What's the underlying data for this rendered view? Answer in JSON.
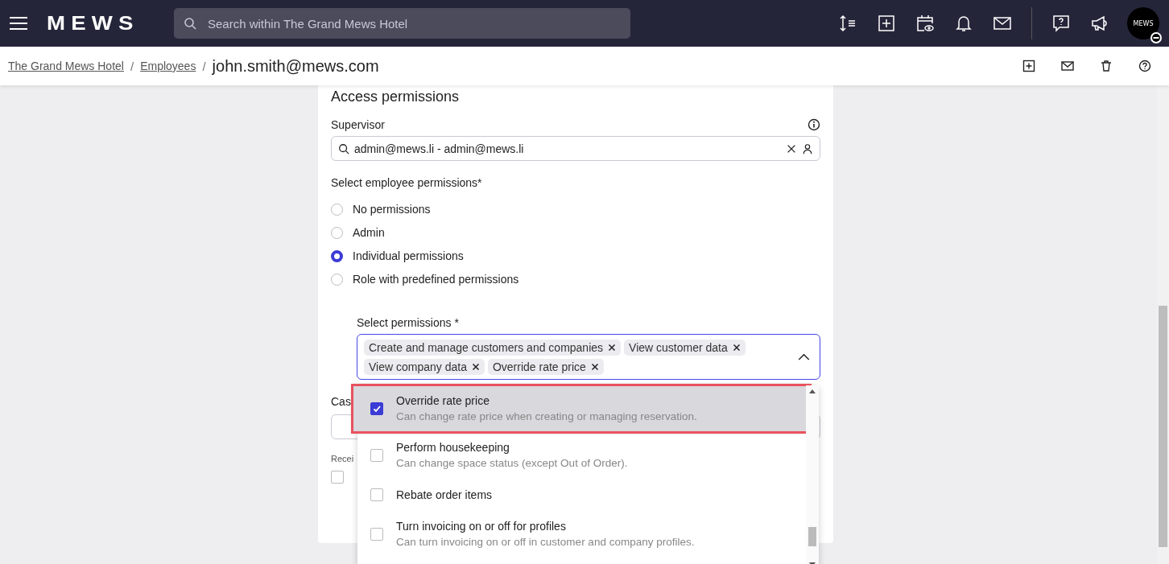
{
  "top_bar": {
    "logo": "MEWS",
    "search": {
      "placeholder": "Search within The Grand Mews Hotel"
    },
    "avatar": {
      "text": "MEWS"
    }
  },
  "breadcrumb": {
    "links": [
      "The Grand Mews Hotel",
      "Employees"
    ],
    "separator": "/",
    "current": "john.smith@mews.com"
  },
  "section": {
    "title": "Access permissions",
    "supervisor": {
      "label": "Supervisor",
      "value": "admin@mews.li - admin@mews.li"
    },
    "permission_type": {
      "label": "Select employee permissions*",
      "options": [
        {
          "label": "No permissions",
          "selected": false
        },
        {
          "label": "Admin",
          "selected": false
        },
        {
          "label": "Individual permissions",
          "selected": true
        },
        {
          "label": "Role with predefined permissions",
          "selected": false
        }
      ]
    },
    "select_permissions": {
      "label": "Select permissions *",
      "expanded": true,
      "chips": [
        "Create and manage customers and companies",
        "View customer data",
        "View company data",
        "Override rate price"
      ],
      "options": [
        {
          "title": "Override rate price",
          "description": "Can change rate price when creating or managing reservation.",
          "checked": true,
          "highlighted": true
        },
        {
          "title": "Perform housekeeping",
          "description": "Can change space status (except Out of Order).",
          "checked": false,
          "highlighted": false
        },
        {
          "title": "Rebate order items",
          "checked": false,
          "highlighted": false
        },
        {
          "title": "Turn invoicing on or off for profiles",
          "description": "Can turn invoicing on or off in customer and company profiles.",
          "checked": false,
          "highlighted": false
        }
      ]
    },
    "covered": {
      "field_label": "Cas",
      "receive_label": "Recei",
      "checkbox_checked": false
    }
  }
}
